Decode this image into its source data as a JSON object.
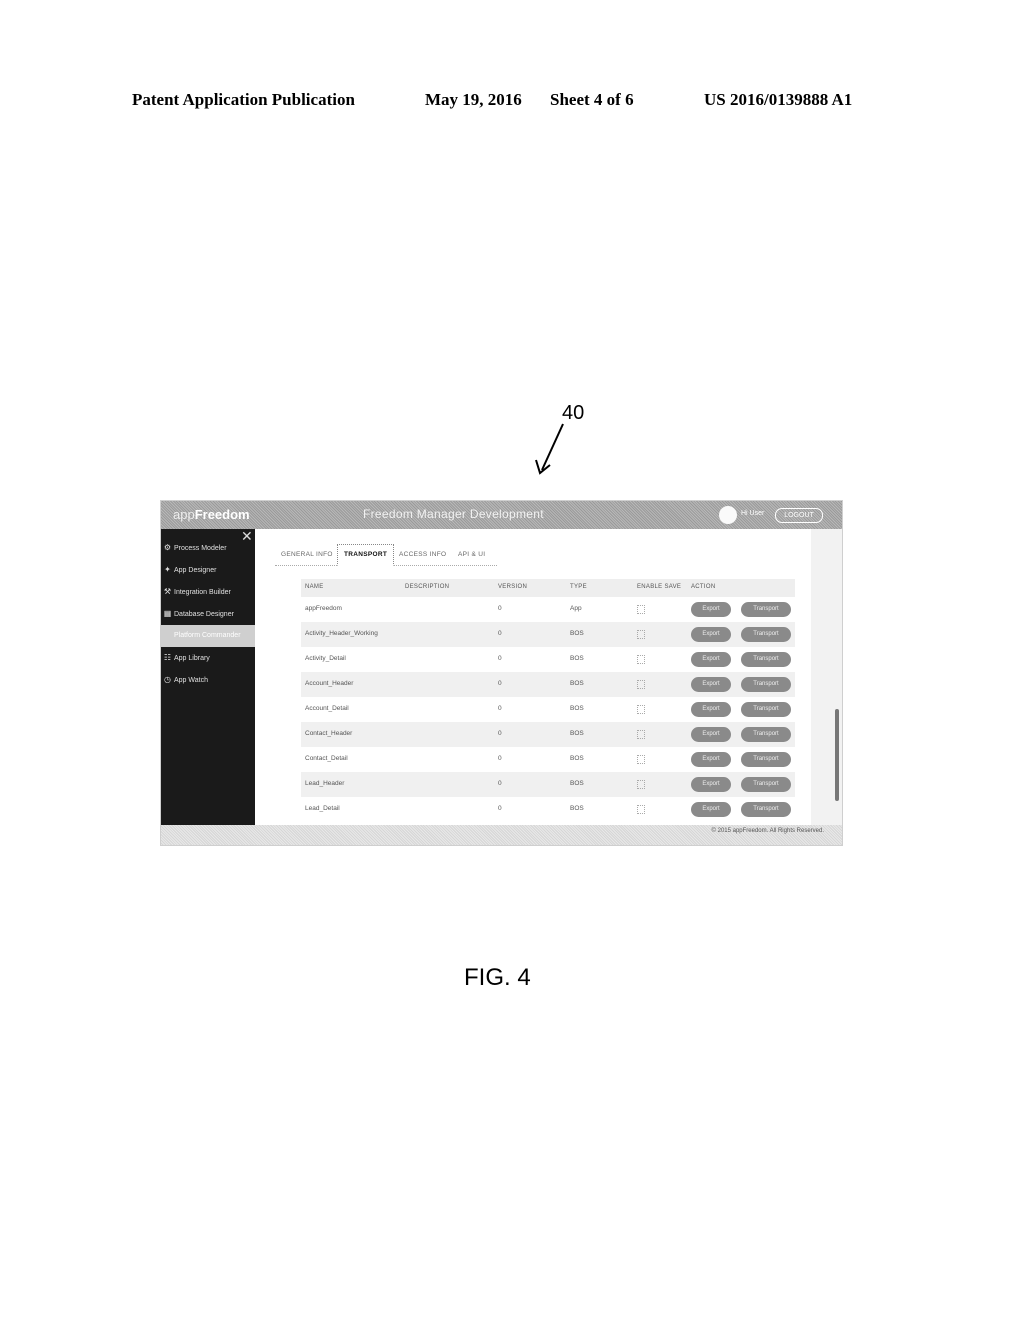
{
  "publication": {
    "title": "Patent Application Publication",
    "date": "May 19, 2016",
    "sheet": "Sheet 4 of 6",
    "number": "US 2016/0139888 A1"
  },
  "figure": {
    "reference": "40",
    "label": "FIG. 4"
  },
  "app": {
    "logo_prefix": "app",
    "logo_brand": "Freedom",
    "title": "Freedom Manager Development",
    "user_name": "Hi User",
    "logout_label": "LOGOUT",
    "close_icon": "close-icon",
    "sidebar": [
      {
        "label": "Process Modeler",
        "icon": "gear-icon",
        "glyph": "⚙"
      },
      {
        "label": "App Designer",
        "icon": "app-icon",
        "glyph": "✦"
      },
      {
        "label": "Integration Builder",
        "icon": "tools-icon",
        "glyph": "⚒"
      },
      {
        "label": "Database Designer",
        "icon": "database-icon",
        "glyph": "▦"
      },
      {
        "label": "Platform Commander",
        "icon": "command-icon",
        "glyph": "",
        "active": true
      },
      {
        "label": "App Library",
        "icon": "library-icon",
        "glyph": "☷"
      },
      {
        "label": "App Watch",
        "icon": "watch-icon",
        "glyph": "◷"
      }
    ],
    "tabs": [
      {
        "label": "GENERAL INFO"
      },
      {
        "label": "TRANSPORT",
        "active": true
      },
      {
        "label": "ACCESS INFO"
      },
      {
        "label": "API & UI"
      }
    ],
    "table": {
      "columns": [
        "NAME",
        "DESCRIPTION",
        "VERSION",
        "TYPE",
        "ENABLE SAVE",
        "ACTION"
      ],
      "rows": [
        {
          "name": "appFreedom",
          "description": "",
          "version": "0",
          "type": "App",
          "enable_save": false
        },
        {
          "name": "Activity_Header_Working",
          "description": "",
          "version": "0",
          "type": "BOS",
          "enable_save": false
        },
        {
          "name": "Activity_Detail",
          "description": "",
          "version": "0",
          "type": "BOS",
          "enable_save": false
        },
        {
          "name": "Account_Header",
          "description": "",
          "version": "0",
          "type": "BOS",
          "enable_save": false
        },
        {
          "name": "Account_Detail",
          "description": "",
          "version": "0",
          "type": "BOS",
          "enable_save": false
        },
        {
          "name": "Contact_Header",
          "description": "",
          "version": "0",
          "type": "BOS",
          "enable_save": false
        },
        {
          "name": "Contact_Detail",
          "description": "",
          "version": "0",
          "type": "BOS",
          "enable_save": false
        },
        {
          "name": "Lead_Header",
          "description": "",
          "version": "0",
          "type": "BOS",
          "enable_save": false
        },
        {
          "name": "Lead_Detail",
          "description": "",
          "version": "0",
          "type": "BOS",
          "enable_save": false
        }
      ],
      "action_buttons": [
        "Export",
        "Transport"
      ]
    },
    "footer": "© 2015 appFreedom. All Rights Reserved."
  }
}
